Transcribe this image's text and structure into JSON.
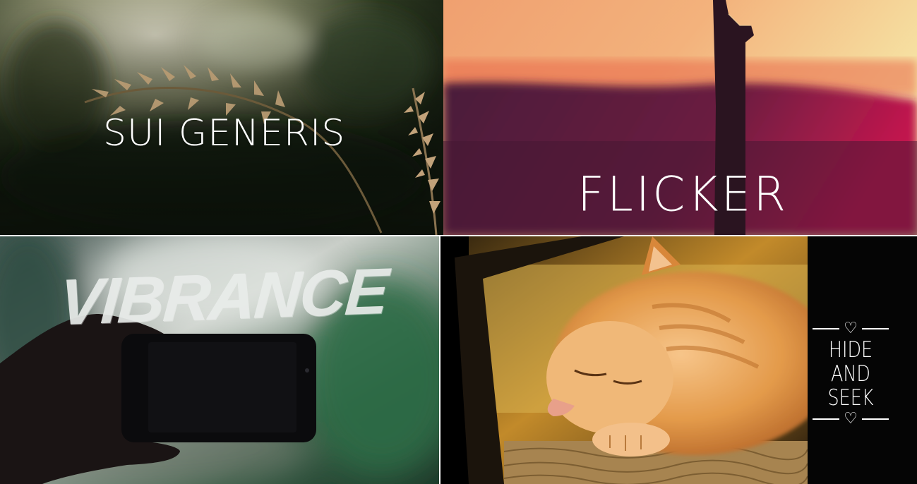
{
  "tiles": [
    {
      "name": "grass-photo",
      "caption": "SUI GENERIS"
    },
    {
      "name": "sunset-photo",
      "caption": "FLICKER"
    },
    {
      "name": "phone-photo",
      "caption": "VIBRANCE"
    },
    {
      "name": "cat-photo",
      "caption_line1": "HIDE AND",
      "caption_line2": "SEEK",
      "heart_glyph": "♡"
    }
  ]
}
